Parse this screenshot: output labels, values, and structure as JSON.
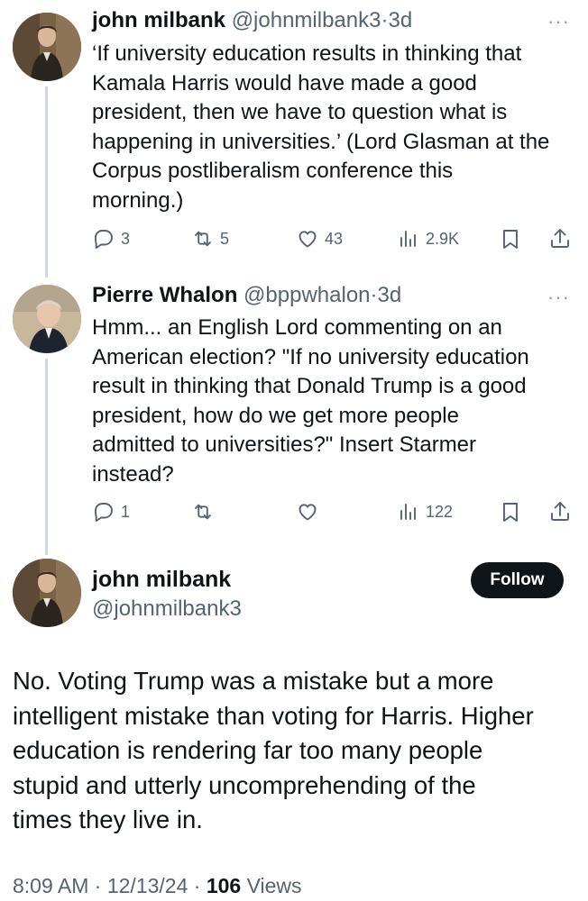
{
  "reply1": {
    "name": "john milbank",
    "handle": "@johnmilbank3",
    "sep": "·",
    "time": "3d",
    "more": "···",
    "text_lines": [
      "‘If university education results in thinking that",
      "Kamala Harris would have made a good",
      "president, then we have to question what is",
      "happening in universities.’ (Lord Glasman at the",
      "Corpus postliberalism conference this",
      "morning.)"
    ],
    "replies": "3",
    "reposts": "5",
    "likes": "43",
    "views": "2.9K",
    "icons": [
      "reply-icon",
      "repost-icon",
      "like-icon",
      "views-icon",
      "bookmark-icon",
      "share-icon"
    ]
  },
  "reply2": {
    "name": "Pierre Whalon",
    "handle": "@bppwhalon",
    "sep": "·",
    "time": "3d",
    "more": "···",
    "text_lines": [
      "Hmm... an English Lord commenting on an",
      "American election? \"If no university education",
      "result in thinking that Donald Trump is a good",
      "president, how do we get more people",
      "admitted to universities?\" Insert Starmer",
      "instead?"
    ],
    "replies": "1",
    "reposts": "",
    "likes": "",
    "views": "122"
  },
  "main": {
    "name": "john milbank",
    "handle": "@johnmilbank3",
    "follow_label": "Follow",
    "text_lines": [
      "No.  Voting Trump was a mistake but a more",
      "intelligent mistake than voting for Harris. Higher",
      "education is rendering far too many people",
      "stupid and utterly uncomprehending of the",
      "times they live in."
    ],
    "time": "8:09 AM",
    "sep": "·",
    "date": "12/13/24",
    "views_count": "106",
    "views_label": "Views"
  }
}
